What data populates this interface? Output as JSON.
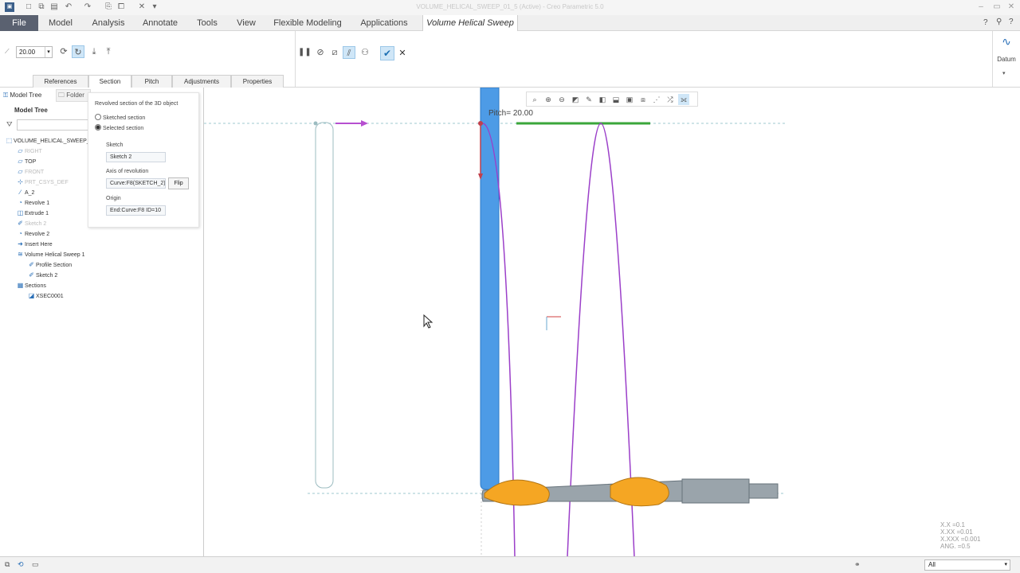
{
  "window": {
    "title": "VOLUME_HELICAL_SWEEP_01_5 (Active) - Creo Parametric 5.0"
  },
  "quick_access": {
    "icons": [
      "app-icon",
      "new-icon",
      "open-icon",
      "save-icon",
      "undo-icon",
      "redo-icon",
      "regenerate-icon",
      "close-window-icon",
      "customize-icon"
    ]
  },
  "window_controls": {
    "minimize": "–",
    "restore": "▭",
    "close": "✕"
  },
  "menu": {
    "file": "File",
    "tabs": [
      "Model",
      "Analysis",
      "Annotate",
      "Tools",
      "View",
      "Flexible Modeling",
      "Applications"
    ],
    "active": "Volume Helical Sweep"
  },
  "ribbon": {
    "pitch_value": "20.00",
    "datum_label": "Datum",
    "dash_tabs": [
      "References",
      "Section",
      "Pitch",
      "Adjustments",
      "Properties"
    ],
    "selected_dash_tab": "Section"
  },
  "sidebar": {
    "tabs": [
      "Model Tree",
      "Folder"
    ],
    "tree_header": "Model Tree",
    "search_placeholder": "",
    "items": [
      {
        "label": "VOLUME_HELICAL_SWEEP_",
        "icon": "part",
        "indent": 0,
        "dim": false
      },
      {
        "label": "RIGHT",
        "icon": "plane",
        "indent": 1,
        "dim": true
      },
      {
        "label": "TOP",
        "icon": "plane",
        "indent": 1,
        "dim": false
      },
      {
        "label": "FRONT",
        "icon": "plane",
        "indent": 1,
        "dim": true
      },
      {
        "label": "PRT_CSYS_DEF",
        "icon": "csys",
        "indent": 1,
        "dim": true
      },
      {
        "label": "A_2",
        "icon": "axis",
        "indent": 1,
        "dim": false
      },
      {
        "label": "Revolve 1",
        "icon": "revolve",
        "indent": 1,
        "dim": false
      },
      {
        "label": "Extrude 1",
        "icon": "extrude",
        "indent": 1,
        "dim": false
      },
      {
        "label": "Sketch 2",
        "icon": "sketch",
        "indent": 1,
        "dim": true
      },
      {
        "label": "Revolve 2",
        "icon": "revolve",
        "indent": 1,
        "dim": false
      },
      {
        "label": "Insert Here",
        "icon": "insert",
        "indent": 1,
        "dim": false
      },
      {
        "label": "Volume Helical Sweep 1",
        "icon": "sweep",
        "indent": 1,
        "dim": false
      },
      {
        "label": "Profile Section",
        "icon": "sketch",
        "indent": 2,
        "dim": false
      },
      {
        "label": "Sketch 2",
        "icon": "sketch",
        "indent": 2,
        "dim": false
      },
      {
        "label": "Sections",
        "icon": "folder",
        "indent": 1,
        "dim": false
      },
      {
        "label": "XSEC0001",
        "icon": "xsec",
        "indent": 2,
        "dim": false
      }
    ]
  },
  "section_panel": {
    "heading": "Revolved section of the 3D object",
    "options": [
      "Sketched section",
      "Selected section"
    ],
    "selected_option": "Selected section",
    "sketch_label": "Sketch",
    "sketch_value": "Sketch 2",
    "axis_label": "Axis of revolution",
    "axis_value": "Curve:F8(SKETCH_2)",
    "flip_label": "Flip",
    "origin_label": "Origin",
    "origin_value": "End:Curve:F8 ID=10"
  },
  "canvas": {
    "pitch_label": "Pitch= 20.00",
    "view_toolbar_icons": [
      "refit-icon",
      "zoom-in-icon",
      "zoom-out-icon",
      "repaint-icon",
      "perspective-icon",
      "display-style-icon",
      "saved-orientations-icon",
      "view-manager-icon",
      "datum-display-icon",
      "annotation-display-icon",
      "spin-center-icon",
      "csys-display-icon"
    ],
    "tolerances": [
      "X.X =0.1",
      "X.XX =0.01",
      "X.XXX =0.001",
      "ANG. =0.5"
    ]
  },
  "status": {
    "filter": "All"
  },
  "colors": {
    "accent": "#2b70b8",
    "sweep_curve": "#9b3fc9",
    "drill_gold": "#f5a623",
    "rod_blue": "#4d9be6",
    "pitch_green": "#3aa63a",
    "file_tab": "#5a6170"
  }
}
